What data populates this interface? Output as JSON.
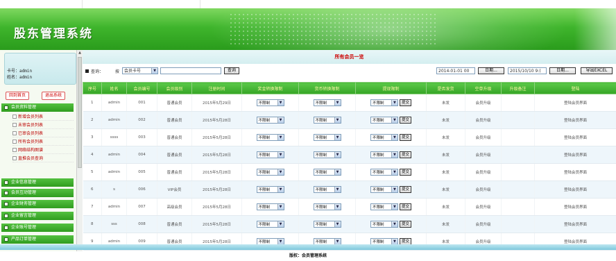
{
  "app": {
    "title": "股东管理系统"
  },
  "colors": {
    "accent": "#36a526",
    "alert": "#dd0000"
  },
  "user": {
    "card_line": "卡号：admin",
    "name_line": "姓名：admin"
  },
  "sidebar": {
    "home_button": "回到首页",
    "logout_button": "退出系统",
    "groups": [
      {
        "label": "会员资料管理",
        "items": [
          "新增会员列表",
          "未审会员列表",
          "已审会员列表",
          "所有会员列表",
          "网络结构图谱",
          "直推会员查询"
        ]
      },
      {
        "label": "企业信息管理"
      },
      {
        "label": "会员互动管理"
      },
      {
        "label": "企业财务管理"
      },
      {
        "label": "企业留言管理"
      },
      {
        "label": "企业账号管理"
      },
      {
        "label": "产品订单管理"
      }
    ]
  },
  "main": {
    "list_title": "所有会员一览",
    "search": {
      "label_query": "查询：",
      "label_by": "按",
      "field_selected": "会员卡号",
      "input_value": "",
      "search_button": "查询",
      "date_from": "2014-01-01 00",
      "date_from_button": "日期...",
      "date_to": "2015/10/10 9:(",
      "date_to_button": "日期...",
      "export_button": "导出EXCEL"
    },
    "columns": [
      "序号",
      "姓名",
      "会员编号",
      "会员级别",
      "注册时间",
      "奖金转换限制",
      "货币转换限制",
      "提现限制",
      "是否发货",
      "空单升级",
      "升级备注",
      "登陆"
    ],
    "select_value": "不限制",
    "submit_label": "提交",
    "rows": [
      {
        "no": "1",
        "name": "admin",
        "code": "001",
        "level": "普通会员",
        "date": "2015年5月29日",
        "ship": "未发",
        "upgrade": "会员升级",
        "note": "",
        "login": "登陆会员界面"
      },
      {
        "no": "2",
        "name": "admin",
        "code": "002",
        "level": "普通会员",
        "date": "2015年5月28日",
        "ship": "未发",
        "upgrade": "会员升级",
        "note": "",
        "login": "登陆会员界面"
      },
      {
        "no": "3",
        "name": "ssss",
        "code": "003",
        "level": "普通会员",
        "date": "2015年5月28日",
        "ship": "未发",
        "upgrade": "会员升级",
        "note": "",
        "login": "登陆会员界面"
      },
      {
        "no": "4",
        "name": "admin",
        "code": "004",
        "level": "普通会员",
        "date": "2015年5月28日",
        "ship": "未发",
        "upgrade": "会员升级",
        "note": "",
        "login": "登陆会员界面"
      },
      {
        "no": "5",
        "name": "admin",
        "code": "005",
        "level": "普通会员",
        "date": "2015年5月28日",
        "ship": "未发",
        "upgrade": "会员升级",
        "note": "",
        "login": "登陆会员界面"
      },
      {
        "no": "6",
        "name": "s",
        "code": "006",
        "level": "VIP会员",
        "date": "2015年5月28日",
        "ship": "未发",
        "upgrade": "会员升级",
        "note": "",
        "login": "登陆会员界面"
      },
      {
        "no": "7",
        "name": "admin",
        "code": "007",
        "level": "高级会员",
        "date": "2015年5月28日",
        "ship": "未发",
        "upgrade": "会员升级",
        "note": "",
        "login": "登陆会员界面"
      },
      {
        "no": "8",
        "name": "sss",
        "code": "008",
        "level": "普通会员",
        "date": "2015年5月28日",
        "ship": "未发",
        "upgrade": "会员升级",
        "note": "",
        "login": "登陆会员界面"
      },
      {
        "no": "9",
        "name": "admin",
        "code": "009",
        "level": "普通会员",
        "date": "2015年5月28日",
        "ship": "未发",
        "upgrade": "会员升级",
        "note": "",
        "login": "登陆会员界面"
      }
    ]
  },
  "footer": {
    "text": "版权：会员管理系统"
  }
}
